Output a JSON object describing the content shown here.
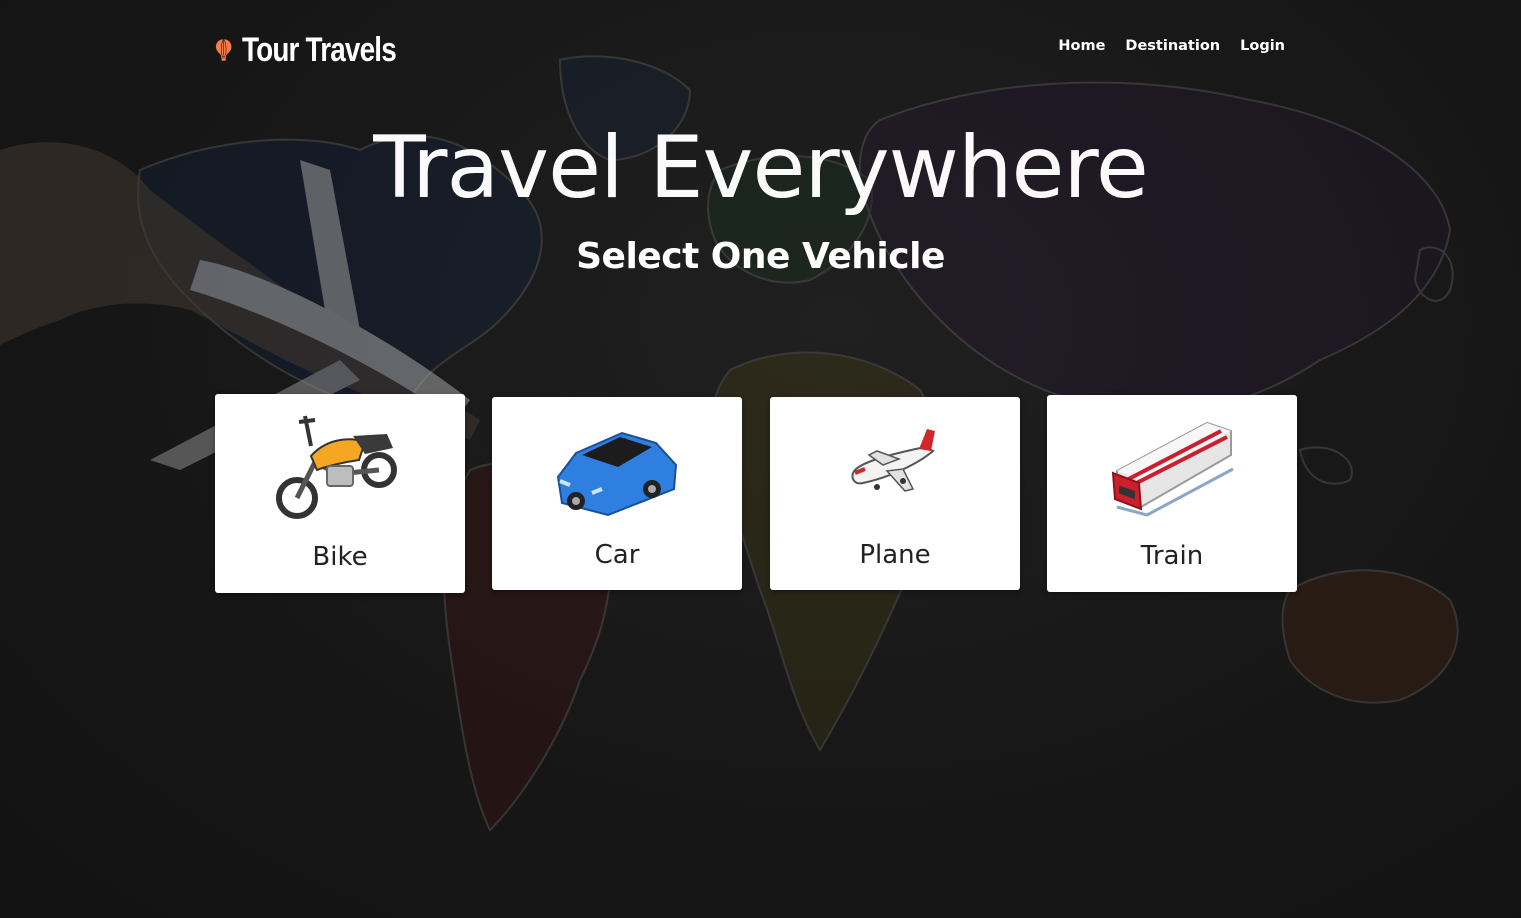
{
  "brand": {
    "name": "Tour Travels",
    "icon": "hot-air-balloon-icon",
    "accent_color": "#f47c48"
  },
  "nav": {
    "items": [
      {
        "label": "Home"
      },
      {
        "label": "Destination"
      },
      {
        "label": "Login"
      }
    ]
  },
  "hero": {
    "title": "Travel Everywhere",
    "subtitle": "Select One Vehicle"
  },
  "vehicles": [
    {
      "label": "Bike",
      "icon": "motorbike-icon"
    },
    {
      "label": "Car",
      "icon": "car-icon"
    },
    {
      "label": "Plane",
      "icon": "airplane-icon"
    },
    {
      "label": "Train",
      "icon": "train-icon"
    }
  ],
  "colors": {
    "background": "#1e1e1e",
    "card_background": "#ffffff",
    "card_text": "#222222",
    "header_text": "#ffffff"
  }
}
